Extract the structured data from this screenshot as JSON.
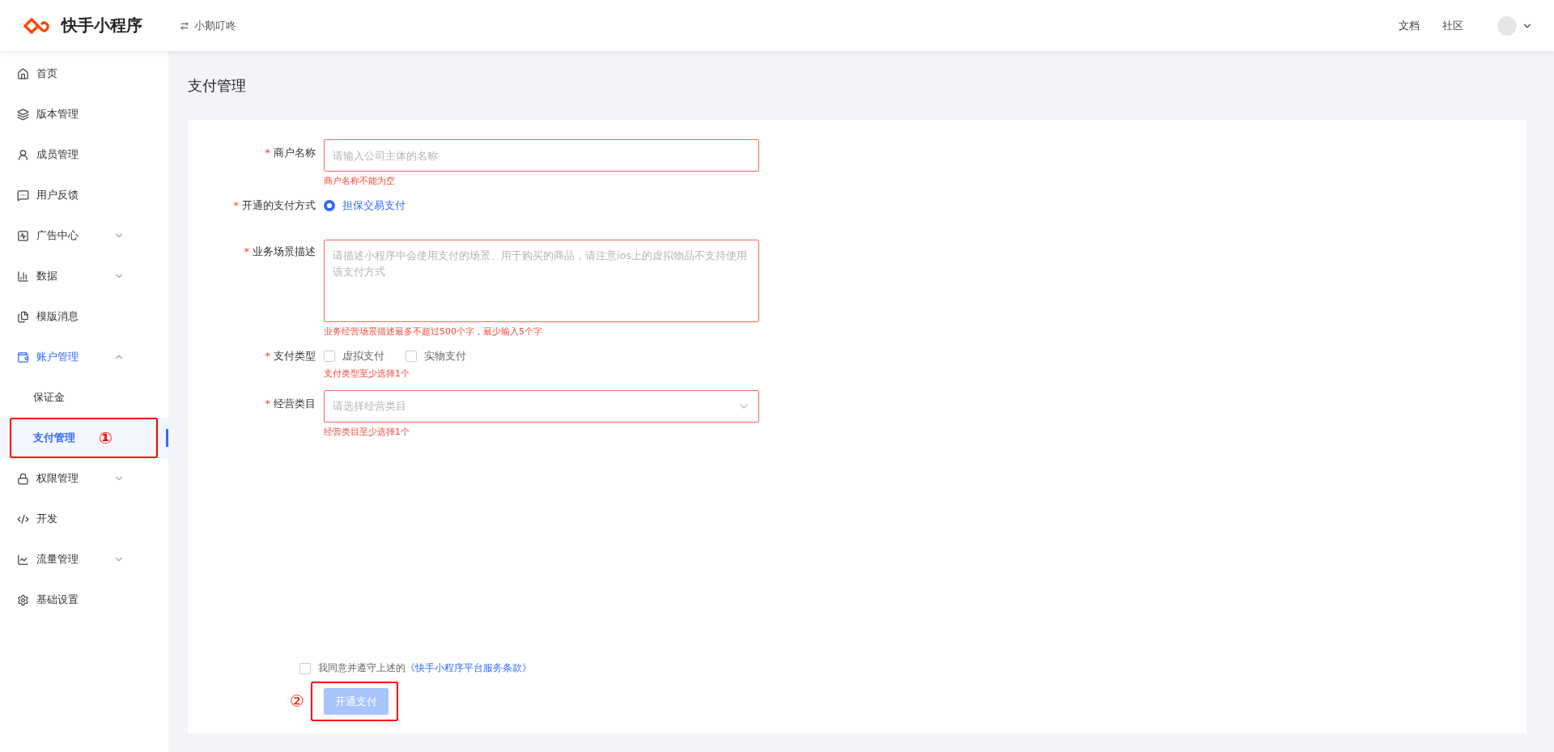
{
  "header": {
    "brand": "快手小程序",
    "app_name": "小鹅叮咚",
    "links": [
      "文档",
      "社区"
    ]
  },
  "sidebar": {
    "items": [
      {
        "label": "首页",
        "selected": false
      },
      {
        "label": "版本管理",
        "selected": false
      },
      {
        "label": "成员管理",
        "selected": false
      },
      {
        "label": "用户反馈",
        "selected": false
      },
      {
        "label": "广告中心",
        "selected": false,
        "expanded": false
      },
      {
        "label": "数据",
        "selected": false,
        "expanded": false
      },
      {
        "label": "模版消息",
        "selected": false
      },
      {
        "label": "账户管理",
        "selected": true,
        "expanded": true,
        "children": [
          {
            "label": "保证金",
            "selected": false
          },
          {
            "label": "支付管理",
            "selected": true,
            "annotation": "①"
          }
        ]
      },
      {
        "label": "权限管理",
        "selected": false,
        "expanded": false
      },
      {
        "label": "开发",
        "selected": false
      },
      {
        "label": "流量管理",
        "selected": false,
        "expanded": false
      },
      {
        "label": "基础设置",
        "selected": false
      }
    ]
  },
  "page_title": "支付管理",
  "form": {
    "fields": [
      {
        "kind": "text",
        "label": "商户名称",
        "required_mark": "*",
        "placeholder": "请输入公司主体的名称",
        "error": "商户名称不能为空"
      },
      {
        "kind": "radio",
        "label": "开通的支付方式",
        "required_mark": "*",
        "options": [
          {
            "label": "担保交易支付",
            "selected": true
          }
        ]
      },
      {
        "kind": "textarea",
        "label": "业务场景描述",
        "required_mark": "*",
        "placeholder": "请描述小程序中会使用支付的场景、用于购买的商品，请注意ios上的虚拟物品不支持使用该支付方式",
        "error": "业务经营场景描述最多不超过500个字，最少输入5个字"
      },
      {
        "kind": "checkboxes",
        "label": "支付类型",
        "required_mark": "*",
        "options": [
          {
            "label": "虚拟支付",
            "checked": false
          },
          {
            "label": "实物支付",
            "checked": false
          }
        ],
        "error": "支付类型至少选择1个"
      },
      {
        "kind": "select",
        "label": "经营类目",
        "required_mark": "*",
        "placeholder": "请选择经营类目",
        "error": "经营类目至少选择1个"
      }
    ]
  },
  "agreement": {
    "checked": false,
    "text": "我同意并遵守上述的",
    "link": "《快手小程序平台服务条款》"
  },
  "submit": {
    "label": "开通支付",
    "disabled": true,
    "annotation": "②"
  }
}
